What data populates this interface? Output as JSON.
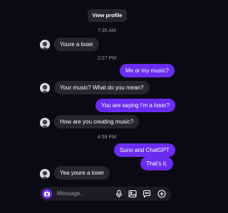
{
  "header": {
    "view_profile_label": "View profile"
  },
  "timestamps": [
    "7:35 AM",
    "2:27 PM",
    "4:59 PM"
  ],
  "messages": [
    {
      "direction": "incoming",
      "text": "Youre a loser"
    },
    {
      "direction": "outgoing",
      "text": "Me or my music?"
    },
    {
      "direction": "incoming",
      "text": "Your music? What do you mean?"
    },
    {
      "direction": "outgoing",
      "text": "You are saying I'm a loser?"
    },
    {
      "direction": "incoming",
      "text": "How are you creating music?"
    },
    {
      "direction": "outgoing",
      "text": "Suno and ChatGPT"
    },
    {
      "direction": "outgoing",
      "text": "That's it."
    },
    {
      "direction": "incoming",
      "text": "Yea youre a loser"
    }
  ],
  "composer": {
    "placeholder": "Message...",
    "icons": [
      "camera-icon",
      "microphone-icon",
      "image-icon",
      "sticker-icon",
      "plus-icon"
    ]
  },
  "colors": {
    "background": "#0b0a14",
    "incoming_bubble": "#262630",
    "outgoing_bubble": "#6a2cf0",
    "timestamp_text": "#9c9ca6"
  }
}
